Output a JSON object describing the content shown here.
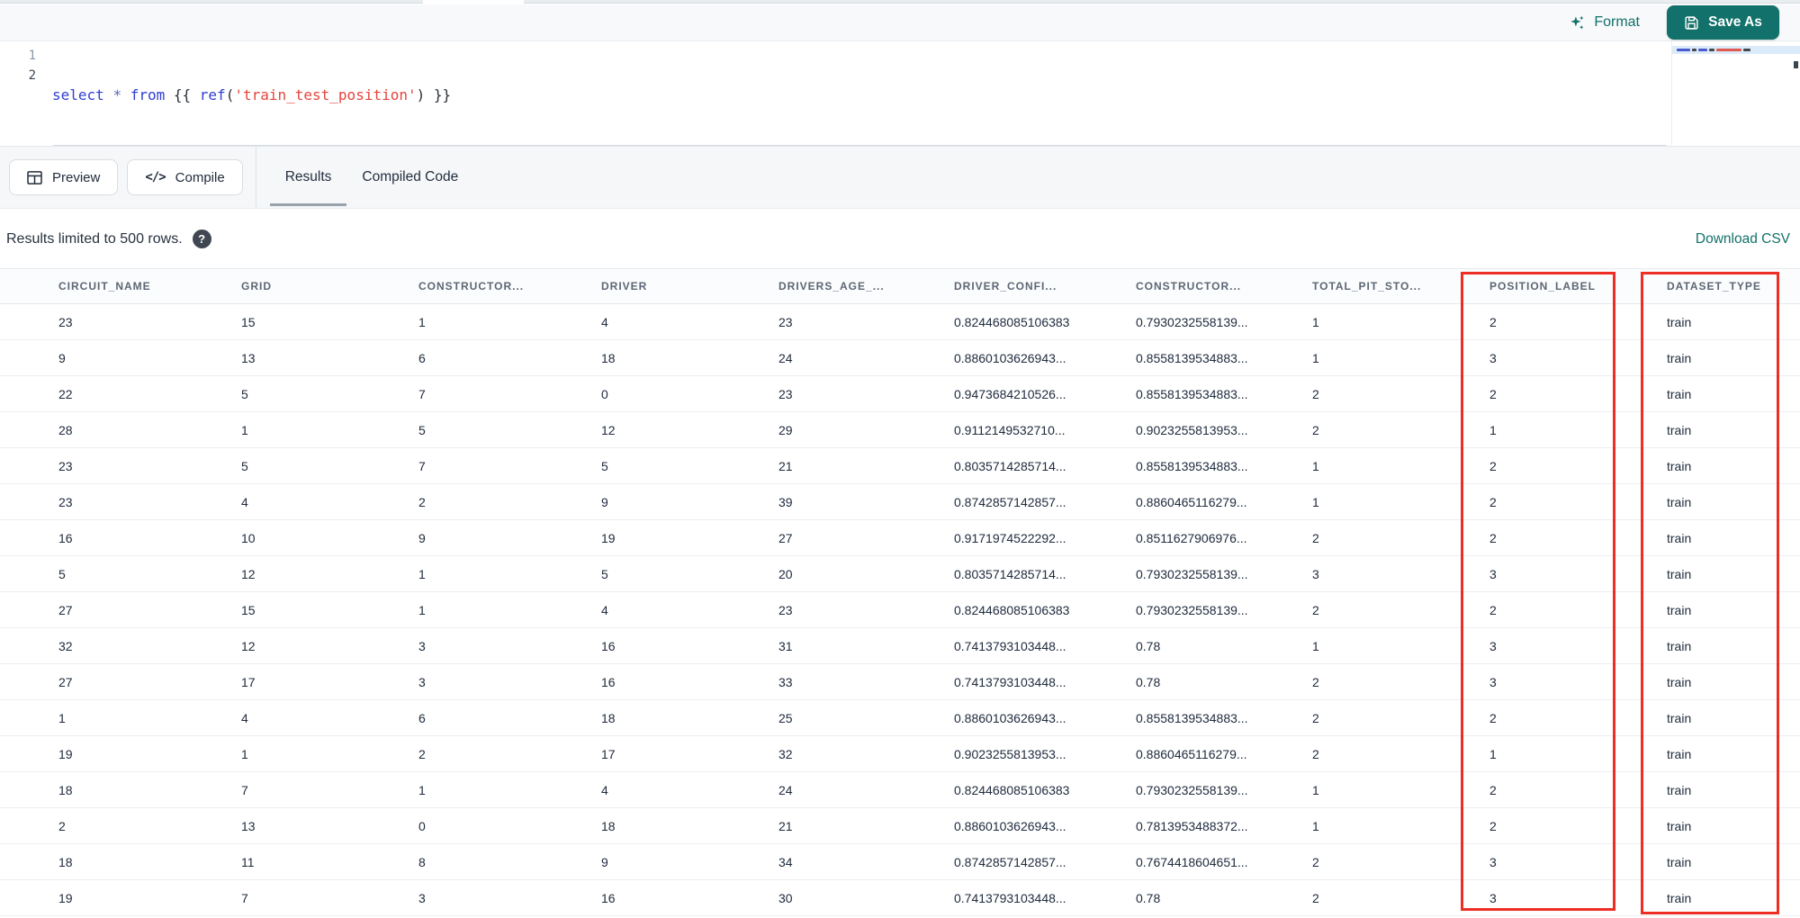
{
  "colors": {
    "accent_teal": "#12716a",
    "annotation_red": "#ee2e24",
    "code_keyword_blue": "#2e3ed2",
    "code_string_red": "#e5443c"
  },
  "toolbar": {
    "format_label": "Format",
    "save_as_label": "Save As"
  },
  "editor": {
    "line_numbers": [
      "1",
      "2"
    ],
    "code_line_1_text": "select * from {{ ref('train_test_position') }}",
    "tokens": [
      {
        "type": "keyword",
        "text": "select"
      },
      {
        "type": "plain",
        "text": " "
      },
      {
        "type": "operator",
        "text": "*"
      },
      {
        "type": "plain",
        "text": " "
      },
      {
        "type": "keyword",
        "text": "from"
      },
      {
        "type": "plain",
        "text": " {{ "
      },
      {
        "type": "function",
        "text": "ref"
      },
      {
        "type": "plain",
        "text": "("
      },
      {
        "type": "string",
        "text": "'train_test_position'"
      },
      {
        "type": "plain",
        "text": ")"
      },
      {
        "type": "plain",
        "text": " }}"
      }
    ]
  },
  "actions": {
    "preview_label": "Preview",
    "compile_label": "Compile",
    "compile_icon_glyph": "</>"
  },
  "tabs": [
    {
      "label": "Results",
      "active": true
    },
    {
      "label": "Compiled Code",
      "active": false
    }
  ],
  "results": {
    "limit_note": "Results limited to 500 rows.",
    "help_glyph": "?",
    "download_label": "Download CSV"
  },
  "annotations": {
    "highlighted_columns": [
      "POSITION_LABEL",
      "DATASET_TYPE"
    ]
  },
  "table": {
    "columns": [
      "CIRCUIT_NAME",
      "GRID",
      "CONSTRUCTOR...",
      "DRIVER",
      "DRIVERS_AGE_...",
      "DRIVER_CONFI...",
      "CONSTRUCTOR...",
      "TOTAL_PIT_STO...",
      "POSITION_LABEL",
      "DATASET_TYPE"
    ],
    "rows": [
      [
        "23",
        "15",
        "1",
        "4",
        "23",
        "0.824468085106383",
        "0.7930232558139...",
        "1",
        "2",
        "train"
      ],
      [
        "9",
        "13",
        "6",
        "18",
        "24",
        "0.8860103626943...",
        "0.8558139534883...",
        "1",
        "3",
        "train"
      ],
      [
        "22",
        "5",
        "7",
        "0",
        "23",
        "0.9473684210526...",
        "0.8558139534883...",
        "2",
        "2",
        "train"
      ],
      [
        "28",
        "1",
        "5",
        "12",
        "29",
        "0.9112149532710...",
        "0.9023255813953...",
        "2",
        "1",
        "train"
      ],
      [
        "23",
        "5",
        "7",
        "5",
        "21",
        "0.8035714285714...",
        "0.8558139534883...",
        "1",
        "2",
        "train"
      ],
      [
        "23",
        "4",
        "2",
        "9",
        "39",
        "0.8742857142857...",
        "0.8860465116279...",
        "1",
        "2",
        "train"
      ],
      [
        "16",
        "10",
        "9",
        "19",
        "27",
        "0.9171974522292...",
        "0.8511627906976...",
        "2",
        "2",
        "train"
      ],
      [
        "5",
        "12",
        "1",
        "5",
        "20",
        "0.8035714285714...",
        "0.7930232558139...",
        "3",
        "3",
        "train"
      ],
      [
        "27",
        "15",
        "1",
        "4",
        "23",
        "0.824468085106383",
        "0.7930232558139...",
        "2",
        "2",
        "train"
      ],
      [
        "32",
        "12",
        "3",
        "16",
        "31",
        "0.7413793103448...",
        "0.78",
        "1",
        "3",
        "train"
      ],
      [
        "27",
        "17",
        "3",
        "16",
        "33",
        "0.7413793103448...",
        "0.78",
        "2",
        "3",
        "train"
      ],
      [
        "1",
        "4",
        "6",
        "18",
        "25",
        "0.8860103626943...",
        "0.8558139534883...",
        "2",
        "2",
        "train"
      ],
      [
        "19",
        "1",
        "2",
        "17",
        "32",
        "0.9023255813953...",
        "0.8860465116279...",
        "2",
        "1",
        "train"
      ],
      [
        "18",
        "7",
        "1",
        "4",
        "24",
        "0.824468085106383",
        "0.7930232558139...",
        "1",
        "2",
        "train"
      ],
      [
        "2",
        "13",
        "0",
        "18",
        "21",
        "0.8860103626943...",
        "0.7813953488372...",
        "1",
        "2",
        "train"
      ],
      [
        "18",
        "11",
        "8",
        "9",
        "34",
        "0.8742857142857...",
        "0.7674418604651...",
        "2",
        "3",
        "train"
      ],
      [
        "19",
        "7",
        "3",
        "16",
        "30",
        "0.7413793103448...",
        "0.78",
        "2",
        "3",
        "train"
      ]
    ]
  }
}
